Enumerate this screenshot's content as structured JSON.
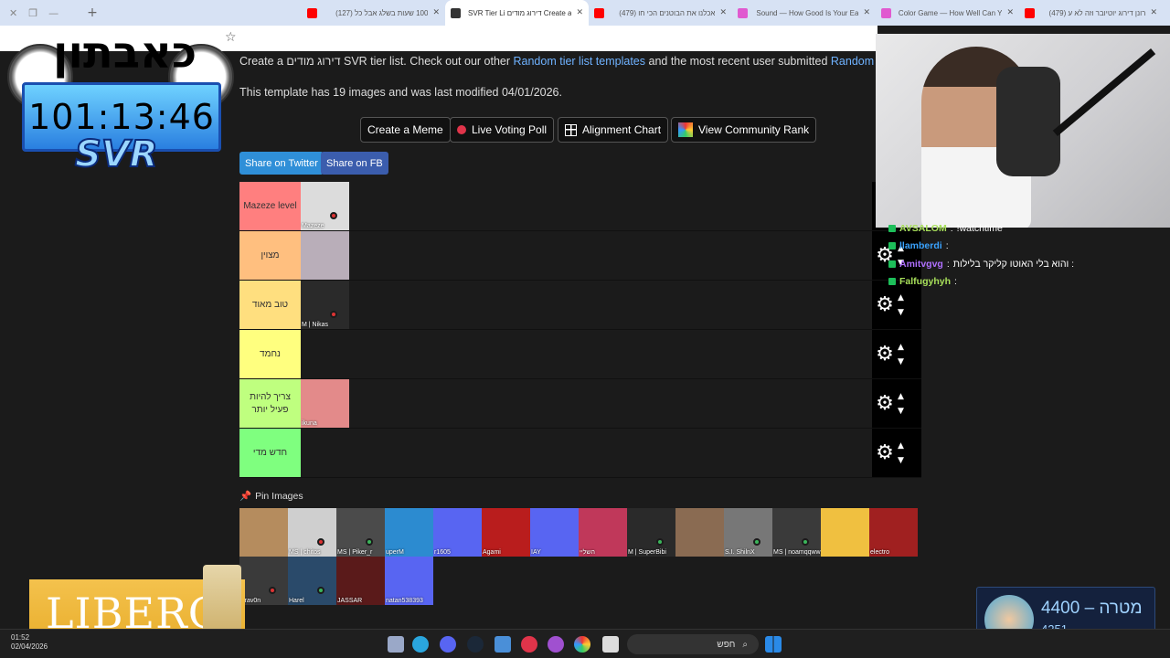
{
  "browser": {
    "tabs": [
      {
        "title": "רונן דירוג יוטיובר וזה לא ע (479)",
        "favicon_color": "#ff0000"
      },
      {
        "title": "Color Game — How Well Can Y",
        "favicon_color": "#e05ad0"
      },
      {
        "title": "Sound — How Good Is Your Ea",
        "favicon_color": "#e05ad0"
      },
      {
        "title": "אכלנו את הבוטנים הכי חו (479)",
        "favicon_color": "#ff0000"
      },
      {
        "title": "Create a דירוג מודים SVR Tier Li",
        "favicon_color": "#333333",
        "active": true
      },
      {
        "title": "100 שעות בשלג אבל כל (127)",
        "favicon_color": "#ff0000"
      }
    ]
  },
  "page": {
    "intro": {
      "prefix": "Create a דירוג מודים SVR tier list. Check out our other ",
      "link1": "Random tier list templates",
      "middle": " and the most recent user submitted ",
      "link2": "Random tier lists",
      "suffix": "."
    },
    "template_info": "This template has 19 images and was last modified 04/01/2026.",
    "buttons": {
      "create_meme": "Create a Meme",
      "live_poll": "Live Voting Poll",
      "alignment": "Alignment Chart",
      "community": "View Community Rank"
    },
    "share": {
      "twitter": "Share on Twitter",
      "fb": "Share on FB"
    },
    "tiers": [
      {
        "label": "Mazeze level",
        "color": "#ff7f7f",
        "items": [
          {
            "caption": "Mazeze",
            "bg": "#dcdcdc",
            "dot": "r"
          }
        ]
      },
      {
        "label": "מצוין",
        "color": "#ffbf7f",
        "items": [
          {
            "caption": "",
            "bg": "#b9aeb9",
            "dot": ""
          }
        ]
      },
      {
        "label": "טוב מאוד",
        "color": "#ffdf7f",
        "items": [
          {
            "caption": "M | Nikas",
            "bg": "#2a2a2a",
            "dot": "r"
          }
        ]
      },
      {
        "label": "נחמד",
        "color": "#ffff7f",
        "items": []
      },
      {
        "label": "צריך להיות פעיל יותר",
        "color": "#bfff7f",
        "items": [
          {
            "caption": "ikuna",
            "bg": "#e38a8a",
            "dot": ""
          }
        ]
      },
      {
        "label": "חדש מדי",
        "color": "#7fff7f",
        "items": []
      }
    ],
    "pin_header": "Pin Images",
    "pins": [
      {
        "caption": "",
        "bg": "#b58c5e",
        "dot": ""
      },
      {
        "caption": "MS | chitos",
        "bg": "#cfcfcf",
        "dot": "r"
      },
      {
        "caption": "MS | Piker_r",
        "bg": "#4b4b4b",
        "dot": "g"
      },
      {
        "caption": "uperM",
        "bg": "#2c8bd0",
        "dot": ""
      },
      {
        "caption": "r1605",
        "bg": "#5865f2",
        "dot": ""
      },
      {
        "caption": "Agami",
        "bg": "#b91d1d",
        "dot": ""
      },
      {
        "caption": "IAY",
        "bg": "#5865f2",
        "dot": ""
      },
      {
        "caption": "השליי",
        "bg": "#c0385a",
        "dot": ""
      },
      {
        "caption": "M | SuperBibi",
        "bg": "#2a2a2a",
        "dot": "g"
      },
      {
        "caption": "",
        "bg": "#8a6b52",
        "dot": ""
      },
      {
        "caption": "S.I. ShilnX",
        "bg": "#777777",
        "dot": "g"
      },
      {
        "caption": "MS | noamqqww",
        "bg": "#3a3a3a",
        "dot": "g"
      },
      {
        "caption": "",
        "bg": "#f0c040",
        "dot": ""
      },
      {
        "caption": "electro",
        "bg": "#a02020",
        "dot": ""
      },
      {
        "caption": "Krav0n",
        "bg": "#3a3a3a",
        "dot": "r"
      },
      {
        "caption": "Harel",
        "bg": "#2a4a6a",
        "dot": "g"
      },
      {
        "caption": "JASSAR",
        "bg": "#5a1a1a",
        "dot": ""
      },
      {
        "caption": "natan538393",
        "bg": "#5865f2",
        "dot": ""
      }
    ]
  },
  "overlay": {
    "channel_logo": "כאבתון",
    "timer": "101:13:46",
    "brand": "SVR",
    "sponsor": "LIBERO",
    "goal_value": "4400",
    "goal_label": "מטרה",
    "goal_sub": "4251",
    "chat": [
      {
        "user": "AVSALOM",
        "user_color": "#a8e05a",
        "msg": "!watchtime"
      },
      {
        "user": "llamberdi",
        "user_color": "#3aa3ff",
        "msg": ""
      },
      {
        "user": "Amitvgvg",
        "user_color": "#b070ff",
        "msg": "והוא בלי האוטו קליקר בלילות :"
      },
      {
        "user": "Falfugyhyh",
        "user_color": "#a8e05a",
        "msg": ""
      }
    ]
  },
  "taskbar": {
    "time": "01:52",
    "date": "02/04/2026",
    "search": "חפש"
  }
}
